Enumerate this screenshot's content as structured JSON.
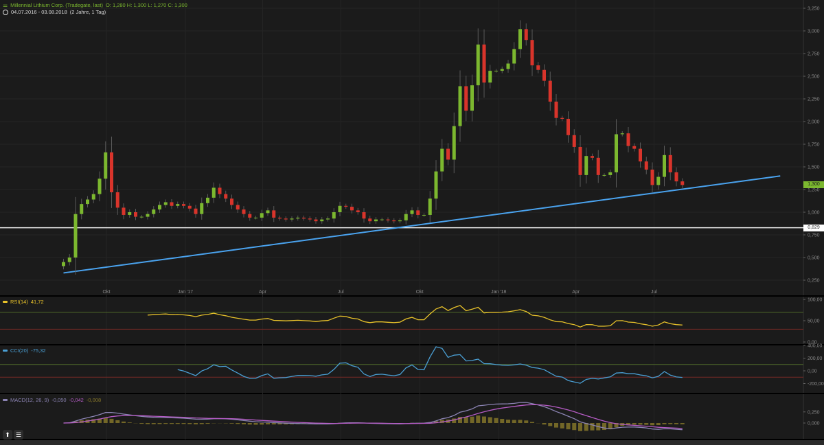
{
  "header": {
    "instrument": "Millennial Lithium Corp. (Tradegate, last)",
    "ohlc": "O: 1,280  H: 1,300  L: 1,270  C: 1,300",
    "range": "04.07.2016 - 03.08.2018",
    "range_note": "(2 Jahre, 1 Tag)"
  },
  "colors": {
    "up": "#7cb82f",
    "down": "#d9342b",
    "trendline": "#4aa3ef",
    "rsi": "#e8c22a",
    "cci": "#4a9fd4",
    "macd": "#8c84b4",
    "signal": "#b65cc6",
    "histogram": "#8a7a2a"
  },
  "price_tags": {
    "last": "1,300",
    "level": "0,829"
  },
  "chart_data": [
    {
      "type": "candlestick",
      "title": "Millennial Lithium Corp. (Tradegate, last)",
      "ylim": [
        0.15,
        3.3
      ],
      "y_ticks": [
        "3,250",
        "3,000",
        "2,750",
        "2,500",
        "2,250",
        "2,000",
        "1,750",
        "1,500",
        "1,250",
        "1,000",
        "0,750",
        "0,500",
        "0,250"
      ],
      "y_tick_values": [
        3.25,
        3.0,
        2.75,
        2.5,
        2.25,
        2.0,
        1.75,
        1.5,
        1.25,
        1.0,
        0.75,
        0.5,
        0.25
      ],
      "x_ticks": [
        {
          "label": "Okt",
          "date": "2016-10-01"
        },
        {
          "label": "Jan '17",
          "date": "2017-01-01"
        },
        {
          "label": "Apr",
          "date": "2017-04-01"
        },
        {
          "label": "Jul",
          "date": "2017-07-01"
        },
        {
          "label": "Okt",
          "date": "2017-10-01"
        },
        {
          "label": "Jan '18",
          "date": "2018-01-01"
        },
        {
          "label": "Apr",
          "date": "2018-04-01"
        },
        {
          "label": "Jul",
          "date": "2018-07-01"
        }
      ],
      "horizontal_line": 0.829,
      "trendline": [
        [
          "2016-08-12",
          0.33
        ],
        [
          "2018-11-25",
          1.4
        ]
      ],
      "dates": [
        "2016-08-12",
        "2016-08-19",
        "2016-08-26",
        "2016-09-02",
        "2016-09-09",
        "2016-09-16",
        "2016-09-23",
        "2016-09-30",
        "2016-10-07",
        "2016-10-14",
        "2016-10-21",
        "2016-10-28",
        "2016-11-04",
        "2016-11-11",
        "2016-11-18",
        "2016-11-25",
        "2016-12-02",
        "2016-12-09",
        "2016-12-16",
        "2016-12-23",
        "2016-12-30",
        "2017-01-06",
        "2017-01-13",
        "2017-01-20",
        "2017-01-27",
        "2017-02-03",
        "2017-02-10",
        "2017-02-17",
        "2017-02-24",
        "2017-03-03",
        "2017-03-10",
        "2017-03-17",
        "2017-03-24",
        "2017-03-31",
        "2017-04-07",
        "2017-04-14",
        "2017-04-21",
        "2017-04-28",
        "2017-05-05",
        "2017-05-12",
        "2017-05-19",
        "2017-05-26",
        "2017-06-02",
        "2017-06-09",
        "2017-06-16",
        "2017-06-23",
        "2017-06-30",
        "2017-07-07",
        "2017-07-14",
        "2017-07-21",
        "2017-07-28",
        "2017-08-04",
        "2017-08-11",
        "2017-08-18",
        "2017-08-25",
        "2017-09-01",
        "2017-09-08",
        "2017-09-15",
        "2017-09-22",
        "2017-09-29",
        "2017-10-06",
        "2017-10-13",
        "2017-10-20",
        "2017-10-27",
        "2017-11-03",
        "2017-11-10",
        "2017-11-17",
        "2017-11-24",
        "2017-12-01",
        "2017-12-08",
        "2017-12-15",
        "2017-12-22",
        "2017-12-29",
        "2018-01-05",
        "2018-01-12",
        "2018-01-19",
        "2018-01-26",
        "2018-02-02",
        "2018-02-09",
        "2018-02-16",
        "2018-02-23",
        "2018-03-02",
        "2018-03-09",
        "2018-03-16",
        "2018-03-23",
        "2018-03-30",
        "2018-04-06",
        "2018-04-13",
        "2018-04-20",
        "2018-04-27",
        "2018-05-04",
        "2018-05-11",
        "2018-05-18",
        "2018-05-25",
        "2018-06-01",
        "2018-06-08",
        "2018-06-15",
        "2018-06-22",
        "2018-06-29",
        "2018-07-06",
        "2018-07-13",
        "2018-07-20",
        "2018-07-27",
        "2018-08-03"
      ],
      "close": [
        0.45,
        0.5,
        0.98,
        1.09,
        1.14,
        1.2,
        1.37,
        1.66,
        1.22,
        1.05,
        0.97,
        1.0,
        0.95,
        0.95,
        0.98,
        1.03,
        1.08,
        1.11,
        1.07,
        1.09,
        1.07,
        1.04,
        0.98,
        1.1,
        1.16,
        1.27,
        1.2,
        1.15,
        1.08,
        1.03,
        0.98,
        0.94,
        0.94,
        0.99,
        1.02,
        0.94,
        0.93,
        0.92,
        0.93,
        0.94,
        0.93,
        0.92,
        0.9,
        0.92,
        0.93,
        1.0,
        1.07,
        1.06,
        1.02,
        1.0,
        0.93,
        0.9,
        0.92,
        0.92,
        0.91,
        0.9,
        0.91,
        0.98,
        1.02,
        0.97,
        0.97,
        1.15,
        1.45,
        1.7,
        1.58,
        1.95,
        2.39,
        2.12,
        2.4,
        2.85,
        2.43,
        2.56,
        2.56,
        2.58,
        2.64,
        2.8,
        3.02,
        2.9,
        2.62,
        2.57,
        2.45,
        2.22,
        2.04,
        2.03,
        1.85,
        1.72,
        1.41,
        1.62,
        1.6,
        1.41,
        1.41,
        1.44,
        1.86,
        1.87,
        1.73,
        1.7,
        1.56,
        1.47,
        1.3,
        1.39,
        1.63,
        1.44,
        1.34,
        1.3
      ]
    },
    {
      "type": "line",
      "name": "RSI(14)",
      "value_label": "41,72",
      "y_ticks": [
        "100,00",
        "50,00",
        "0,00"
      ],
      "y_tick_values": [
        100,
        50,
        0
      ],
      "ylim": [
        0,
        100
      ],
      "bands": [
        70,
        30
      ]
    },
    {
      "type": "line",
      "name": "CCI(20)",
      "value_label": "-75,32",
      "y_ticks": [
        "400,00",
        "200,00",
        "0,00",
        "-200,00"
      ],
      "y_tick_values": [
        400,
        200,
        0,
        -200
      ],
      "ylim": [
        -250,
        410
      ],
      "bands": [
        100,
        -100
      ]
    },
    {
      "type": "line",
      "name": "MACD(12, 26, 9)",
      "value_labels": [
        "-0,050",
        "-0,042",
        "-0,008"
      ],
      "y_ticks": [
        "0,250",
        "0,000"
      ],
      "y_tick_values": [
        0.25,
        0
      ]
    }
  ]
}
